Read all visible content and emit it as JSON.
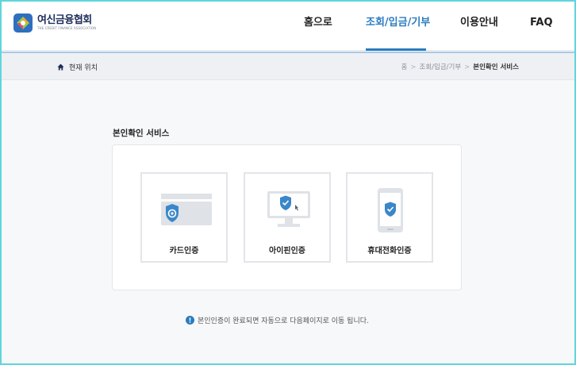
{
  "header": {
    "logo_title": "여신금융협회",
    "logo_subtitle": "THE CREDIT FINANCE ASSOCIATION",
    "nav": [
      {
        "label": "홈으로",
        "active": false
      },
      {
        "label": "조회/입금/기부",
        "active": true
      },
      {
        "label": "이용안내",
        "active": false
      },
      {
        "label": "FAQ",
        "active": false
      }
    ]
  },
  "breadcrumb": {
    "location_label": "현재 위치",
    "items": [
      "홈",
      "조회/입금/기부",
      "본인확인 서비스"
    ]
  },
  "main": {
    "section_title": "본인확인 서비스",
    "methods": [
      {
        "label": "카드인증",
        "icon": "card-shield-icon"
      },
      {
        "label": "아이핀인증",
        "icon": "monitor-shield-icon"
      },
      {
        "label": "휴대전화인증",
        "icon": "phone-shield-icon"
      }
    ],
    "notice": "본인인증이 완료되면 자동으로 다음페이지로 이동 됩니다."
  },
  "colors": {
    "accent": "#2a7bc0",
    "frame_border": "#5fd6dc",
    "shield": "#3a87c9"
  }
}
